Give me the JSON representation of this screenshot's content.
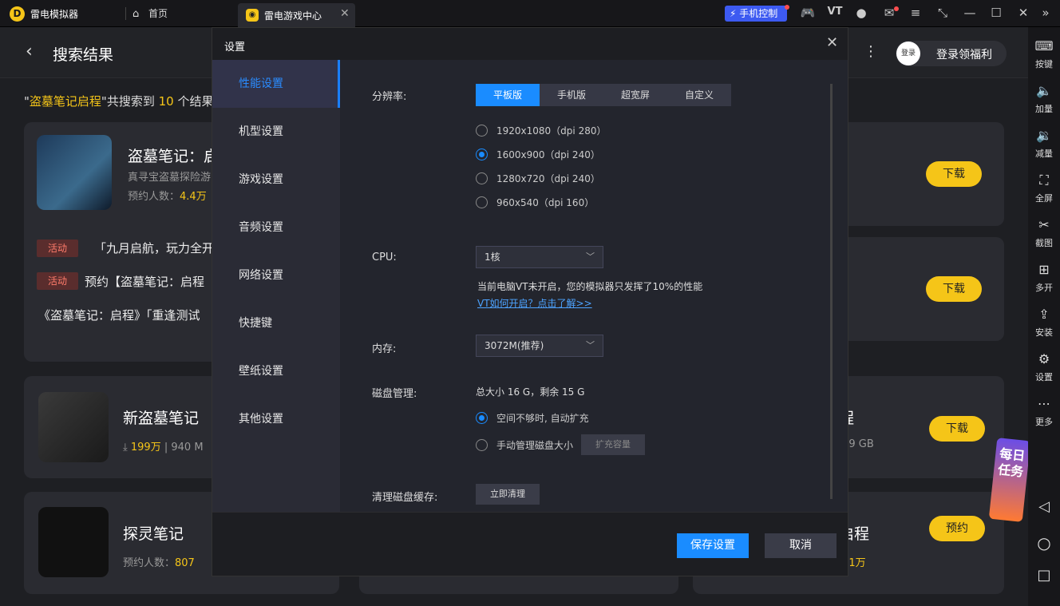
{
  "titlebar": {
    "app_title": "雷电模拟器",
    "home_label": "首页",
    "tab_label": "雷电游戏中心",
    "phone_control": "手机控制",
    "vt_label": "VT"
  },
  "header": {
    "title": "搜索结果",
    "login_avatar": "登录",
    "login_label": "登录领福利"
  },
  "summary": {
    "prefix": "\"",
    "keyword": "盗墓笔记启程",
    "middle": "\"共搜索到 ",
    "count": "10",
    "suffix": " 个结果"
  },
  "results": [
    {
      "name": "盗墓笔记：启",
      "desc": "真寻宝盗墓探险游",
      "meta_label": "预约人数：",
      "meta_value": "4.4万",
      "button": "下载"
    },
    {
      "button": "下载"
    },
    {
      "name": "新盗墓笔记",
      "downloads": "199万",
      "size": "940 M",
      "button": "下载"
    },
    {
      "name_tail": "程",
      "size": "1.9 GB",
      "button": "下载"
    },
    {
      "name": "探灵笔记",
      "meta_label": "预约人数：",
      "meta_value": "807"
    },
    {
      "name_tail": "启程",
      "meta_value": "1.1万",
      "button": "预约"
    }
  ],
  "activities": [
    {
      "tag": "活动",
      "text": "「九月启航，玩力全开"
    },
    {
      "tag": "活动",
      "text": "预约【盗墓笔记：启程"
    },
    {
      "text": "《盗墓笔记：启程》「重逢测试"
    }
  ],
  "rightbar": [
    {
      "icon": "keyboard-icon",
      "glyph": "⌨",
      "label": "按键"
    },
    {
      "icon": "volume-up-icon",
      "glyph": "🔈",
      "label": "加量"
    },
    {
      "icon": "volume-down-icon",
      "glyph": "🔉",
      "label": "减量"
    },
    {
      "icon": "fullscreen-icon",
      "glyph": "⛶",
      "label": "全屏"
    },
    {
      "icon": "scissors-icon",
      "glyph": "✂",
      "label": "截图"
    },
    {
      "icon": "multi-open-icon",
      "glyph": "⊞",
      "label": "多开"
    },
    {
      "icon": "apk-icon",
      "glyph": "⇪",
      "label": "安装"
    },
    {
      "icon": "settings-icon",
      "glyph": "⚙",
      "label": "设置"
    },
    {
      "icon": "more-icon",
      "glyph": "⋯",
      "label": "更多"
    }
  ],
  "nav": {
    "back": "◁",
    "home": "○",
    "recent": "□"
  },
  "daily_badge": "每日任务",
  "dialog": {
    "title": "设置",
    "sidebar": [
      "性能设置",
      "机型设置",
      "游戏设置",
      "音频设置",
      "网络设置",
      "快捷键",
      "壁纸设置",
      "其他设置"
    ],
    "resolution_label": "分辨率:",
    "resolution_tabs": [
      "平板版",
      "手机版",
      "超宽屏",
      "自定义"
    ],
    "resolution_options": [
      "1920x1080（dpi 280）",
      "1600x900（dpi 240）",
      "1280x720（dpi 240）",
      "960x540（dpi 160）"
    ],
    "cpu_label": "CPU:",
    "cpu_value": "1核",
    "vt_note": "当前电脑VT未开启，您的模拟器只发挥了10%的性能",
    "vt_link": "VT如何开启？点击了解>>",
    "memory_label": "内存:",
    "memory_value": "3072M(推荐)",
    "disk_label": "磁盘管理:",
    "disk_info": "总大小 16 G，剩余 15 G",
    "disk_options": [
      "空间不够时, 自动扩充",
      "手动管理磁盘大小"
    ],
    "expand_button": "扩充容量",
    "cache_label": "清理磁盘缓存:",
    "clean_button": "立即清理",
    "save_button": "保存设置",
    "cancel_button": "取消"
  },
  "colors": {
    "accent": "#1a8cff",
    "brand_yellow": "#f5c518",
    "dialog_bg": "#23252d"
  }
}
